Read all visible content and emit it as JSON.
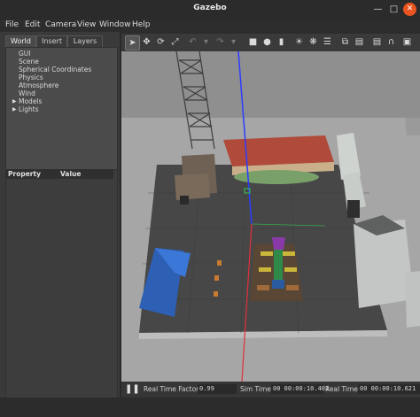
{
  "window": {
    "title": "Gazebo"
  },
  "menu": {
    "file": "File",
    "edit": "Edit",
    "camera": "Camera",
    "view": "View",
    "window": "Window",
    "help": "Help"
  },
  "left_panel": {
    "tabs": {
      "world": "World",
      "insert": "Insert",
      "layers": "Layers"
    },
    "tree": [
      "GUI",
      "Scene",
      "Spherical Coordinates",
      "Physics",
      "Atmosphere",
      "Wind",
      "Models",
      "Lights"
    ],
    "property_header": "Property",
    "value_header": "Value"
  },
  "toolbar": {
    "icons": [
      "select-arrow-icon",
      "translate-icon",
      "rotate-icon",
      "scale-icon",
      "undo-icon",
      "redo-icon",
      "box-icon",
      "sphere-icon",
      "cylinder-icon",
      "point-light-icon",
      "spot-light-icon",
      "directional-light-icon",
      "copy-icon",
      "paste-icon",
      "align-icon",
      "snap-icon",
      "change-view-icon"
    ]
  },
  "status": {
    "real_time_factor_label": "Real Time Factor:",
    "real_time_factor": "0.99",
    "sim_time_label": "Sim Time:",
    "sim_time": "00 00:00:10.401",
    "real_time_label": "Real Time:",
    "real_time": "00 00:00:10.621"
  },
  "colors": {
    "accent": "#e95420",
    "viewport_bg": "#8a8a8a",
    "ground": "#454545"
  }
}
